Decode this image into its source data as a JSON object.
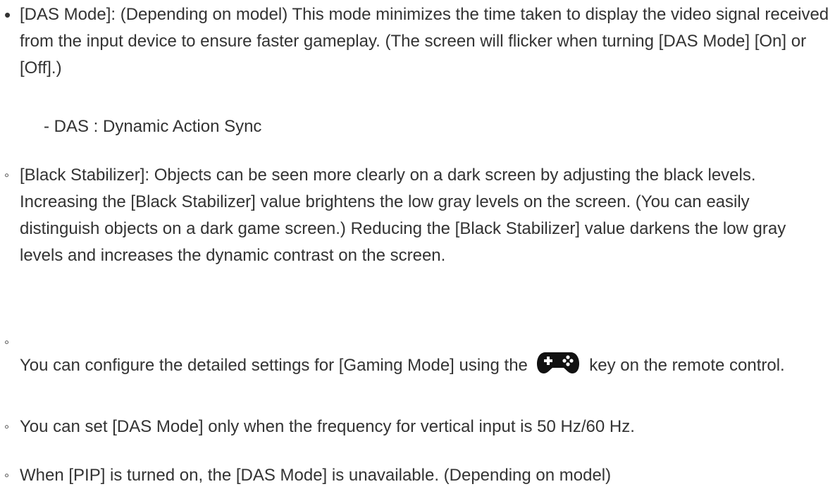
{
  "item1": {
    "marker": "•",
    "text": "[DAS Mode]: (Depending on model) This mode minimizes the time taken to display the video signal received from the input device to ensure faster gameplay. (The screen will flicker when turning [DAS Mode] [On] or [Off].)"
  },
  "item1_sub": "- DAS : Dynamic Action Sync",
  "item2": {
    "marker": "◦",
    "text": "[Black Stabilizer]: Objects can be seen more clearly on a dark screen by adjusting the black levels. Increasing the [Black Stabilizer] value brightens the low gray levels on the screen. (You can easily distinguish objects on a dark game screen.) Reducing the [Black Stabilizer] value darkens the low gray levels and increases the dynamic contrast on the screen."
  },
  "item3": {
    "marker": "◦",
    "text_before": "You can configure the detailed settings for [Gaming Mode] using the",
    "icon": "gamepad-icon",
    "text_after": "key on the remote control."
  },
  "item4": {
    "marker": "◦",
    "text": "You can set [DAS Mode] only when the frequency for vertical input is 50 Hz/60 Hz."
  },
  "item5": {
    "marker": "◦",
    "text": "When [PIP] is turned on, the [DAS Mode] is unavailable. (Depending on model)"
  }
}
